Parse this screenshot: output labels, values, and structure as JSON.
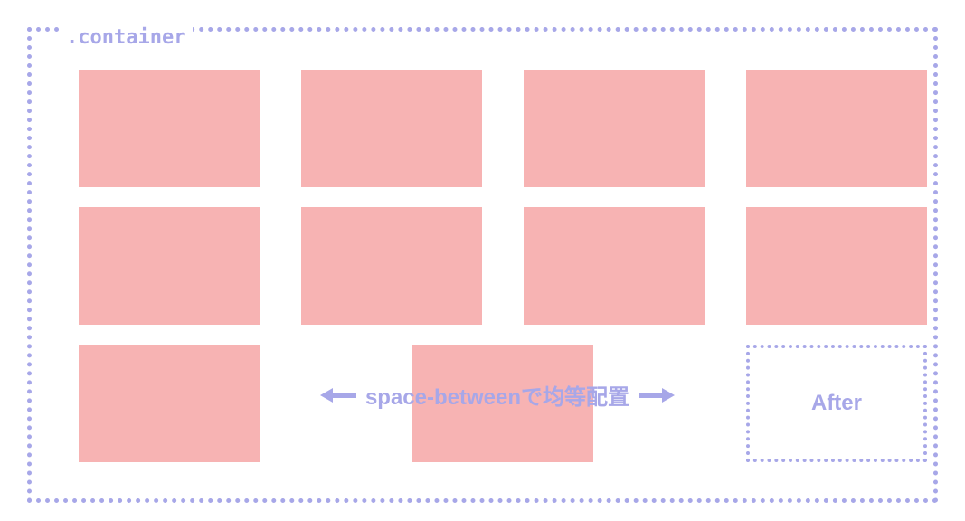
{
  "container": {
    "label": ".container"
  },
  "annotation": {
    "text": "space-betweenで均等配置"
  },
  "after": {
    "label": "After"
  }
}
